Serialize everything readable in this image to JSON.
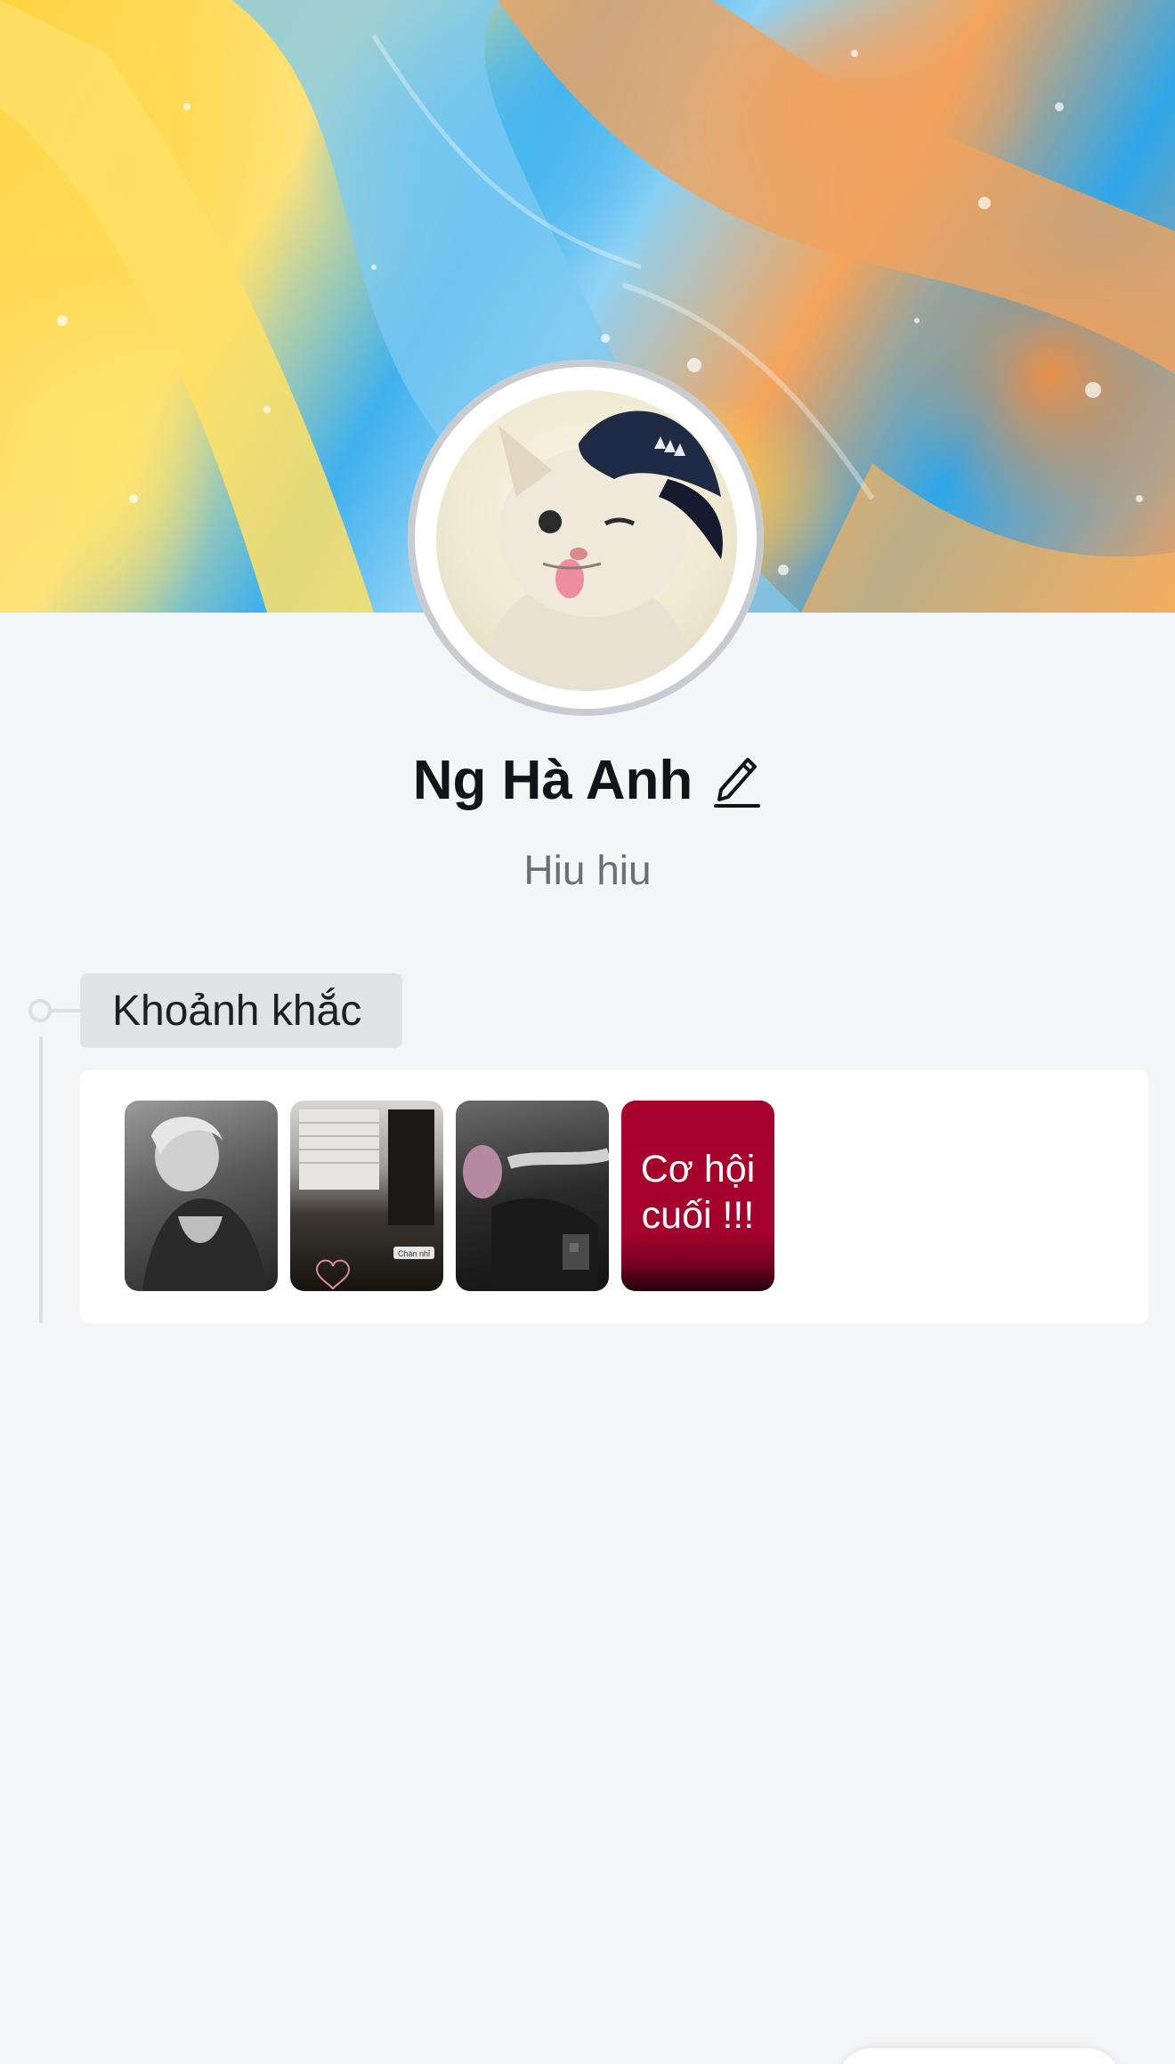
{
  "profile": {
    "name": "Ng Hà Anh",
    "bio": "Hiu hiu"
  },
  "moments": {
    "section_title": "Khoảnh khắc",
    "items": [
      {
        "kind": "photo",
        "text": "",
        "caption": ""
      },
      {
        "kind": "photo",
        "text": "",
        "caption": "Chán nhỉ"
      },
      {
        "kind": "photo",
        "text": "",
        "caption": ""
      },
      {
        "kind": "text",
        "text": "Cơ hội cuối !!!",
        "background": "#a6012d"
      }
    ]
  },
  "icons": {
    "edit": "pencil-icon"
  },
  "colors": {
    "background": "#f4f5f7",
    "card": "#ffffff",
    "tag_background": "#e1e2e4",
    "avatar_ring": "#c8ccd1"
  }
}
